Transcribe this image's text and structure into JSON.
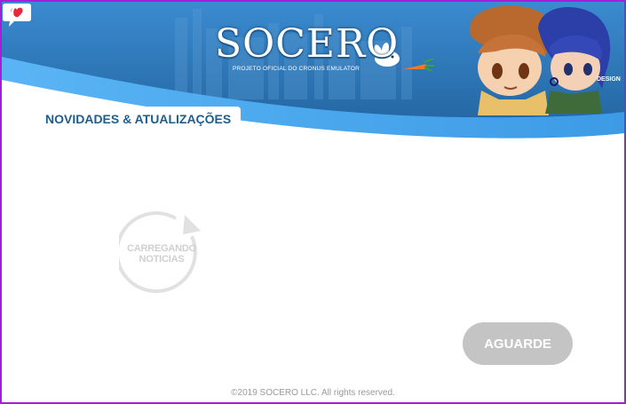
{
  "header": {
    "logo_text": "SOCERO",
    "logo_subtitle": "Projeto Oficial do Cronus Emulator",
    "design_label": "DESIGN"
  },
  "section": {
    "title": "NOVIDADES & ATUALIZAÇÕES"
  },
  "loader": {
    "line1": "CARREGANDO",
    "line2": "NOTICIAS"
  },
  "actions": {
    "wait_label": "AGUARDE"
  },
  "footer": {
    "copyright": "©2019 SOCERO LLC. All rights reserved."
  },
  "colors": {
    "frame_border": "#a21fd6",
    "banner_blue": "#2f7fc0",
    "wave_light": "#4aa6ee",
    "title_blue": "#1d5e8c",
    "button_gray": "#c4c4c4"
  }
}
